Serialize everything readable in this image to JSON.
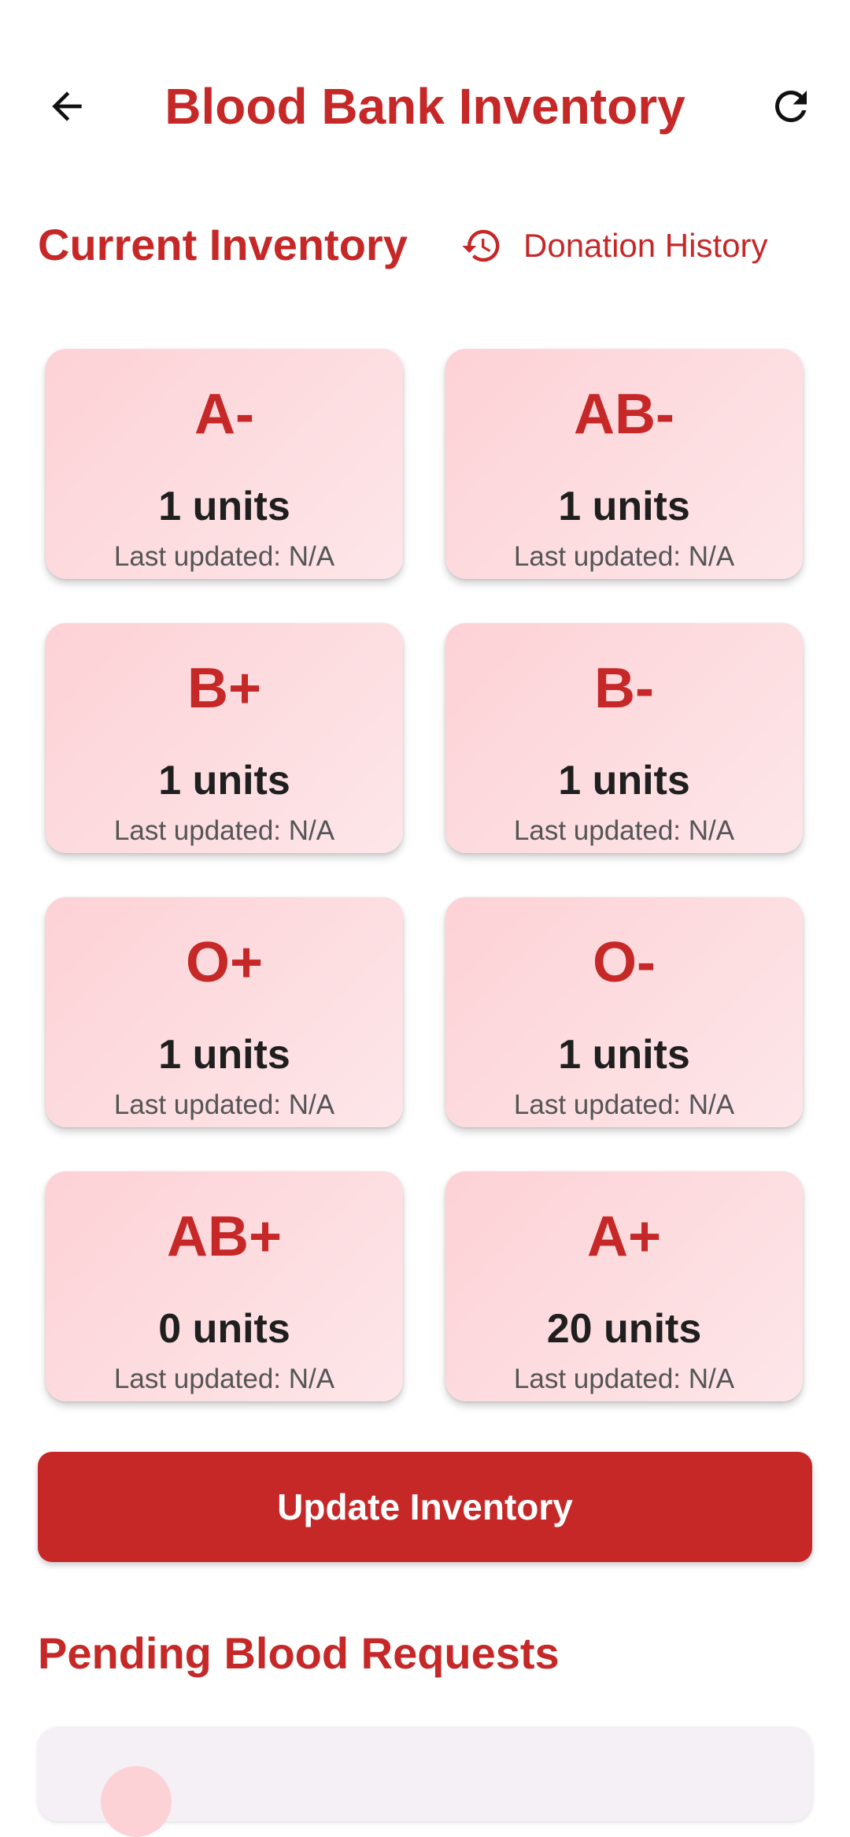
{
  "app_bar": {
    "title": "Blood Bank Inventory",
    "back_icon": "arrow-left-icon",
    "refresh_icon": "refresh-icon"
  },
  "inventory_section": {
    "heading": "Current Inventory",
    "history_link": "Donation History",
    "history_icon": "history-icon"
  },
  "inventory": [
    {
      "type": "A-",
      "units": "1 units",
      "updated": "Last updated: N/A"
    },
    {
      "type": "AB-",
      "units": "1 units",
      "updated": "Last updated: N/A"
    },
    {
      "type": "B+",
      "units": "1 units",
      "updated": "Last updated: N/A"
    },
    {
      "type": "B-",
      "units": "1 units",
      "updated": "Last updated: N/A"
    },
    {
      "type": "O+",
      "units": "1 units",
      "updated": "Last updated: N/A"
    },
    {
      "type": "O-",
      "units": "1 units",
      "updated": "Last updated: N/A"
    },
    {
      "type": "AB+",
      "units": "0 units",
      "updated": "Last updated: N/A"
    },
    {
      "type": "A+",
      "units": "20 units",
      "updated": "Last updated: N/A"
    }
  ],
  "update_button": "Update Inventory",
  "pending_section": {
    "heading": "Pending Blood Requests"
  },
  "colors": {
    "accent": "#c62828",
    "card_bg": "#fdd2d6",
    "button_text": "#ffffff"
  }
}
